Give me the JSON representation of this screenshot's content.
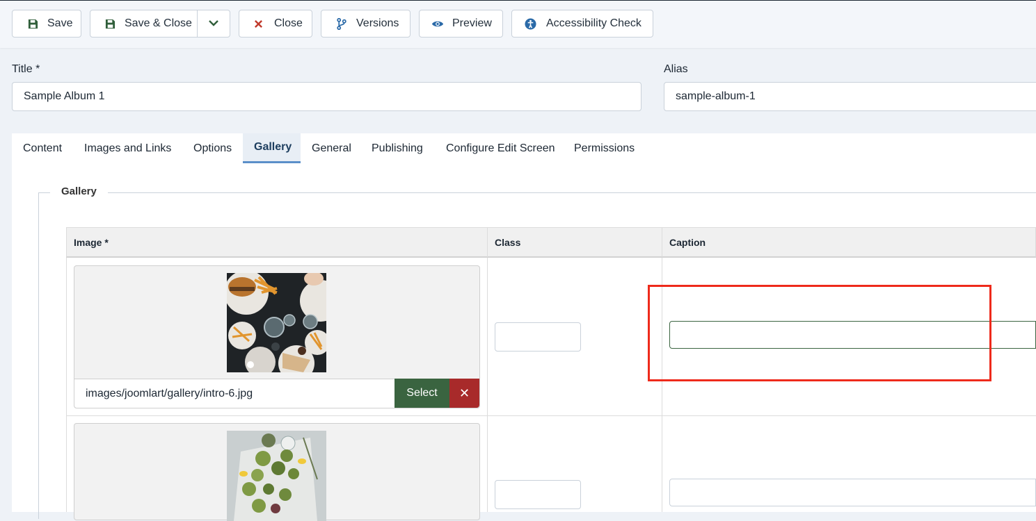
{
  "toolbar": {
    "save": "Save",
    "save_close": "Save & Close",
    "close": "Close",
    "versions": "Versions",
    "preview": "Preview",
    "accessibility": "Accessibility Check"
  },
  "form": {
    "title_label": "Title *",
    "title_value": "Sample Album 1",
    "alias_label": "Alias",
    "alias_value": "sample-album-1"
  },
  "tabs": [
    {
      "label": "Content"
    },
    {
      "label": "Images and Links"
    },
    {
      "label": "Options"
    },
    {
      "label": "Gallery"
    },
    {
      "label": "General"
    },
    {
      "label": "Publishing"
    },
    {
      "label": "Configure Edit Screen"
    },
    {
      "label": "Permissions"
    }
  ],
  "active_tab": "Gallery",
  "gallery": {
    "legend": "Gallery",
    "columns": {
      "image": "Image *",
      "class": "Class",
      "caption": "Caption"
    },
    "rows": [
      {
        "image_path": "images/joomlart/gallery/intro-6.jpg",
        "class": "",
        "caption": "",
        "select_label": "Select",
        "clear_label": "✕"
      },
      {
        "image_path": "",
        "class": "",
        "caption": ""
      }
    ]
  },
  "colors": {
    "accent_green": "#3a6440",
    "danger_red": "#a82a2a",
    "tab_underline": "#5b8fc9",
    "highlight": "#ee2a1b"
  }
}
